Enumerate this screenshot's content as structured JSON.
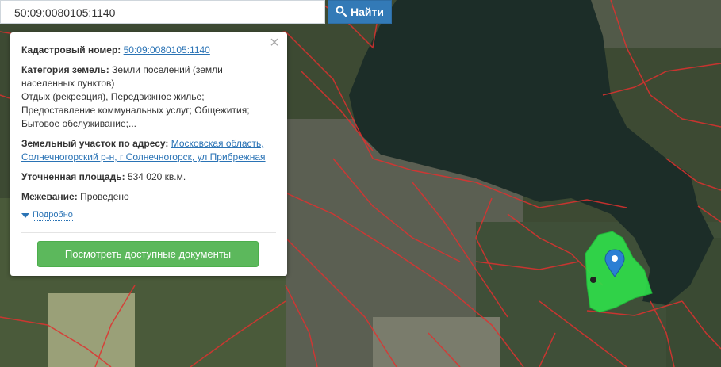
{
  "search": {
    "value": "50:09:0080105:1140",
    "button_label": "Найти"
  },
  "popup": {
    "cadastral_label": "Кадастровый номер:",
    "cadastral_value": "50:09:0080105:1140",
    "category_label": "Категория земель:",
    "category_text": "Земли поселений (земли населенных пунктов)",
    "usage_text": "Отдых (рекреация), Передвижное жилье; Предоставление коммунальных услуг; Общежития; Бытовое обслуживание;...",
    "address_label": "Земельный участок по адресу:",
    "address_value": "Московская область, Солнечногорский р-н, г Солнечногорск, ул Прибрежная",
    "area_label": "Уточненная площадь:",
    "area_value": "534 020 кв.м.",
    "survey_label": "Межевание:",
    "survey_value": "Проведено",
    "more_label": "Подробно",
    "docs_button_label": "Посмотреть доступные документы"
  },
  "colors": {
    "search_button": "#337ab7",
    "docs_button": "#5cb85c",
    "parcel_border": "#e0312f",
    "selected_parcel": "#2fe04a",
    "marker": "#2b7fd4",
    "lake": "#1c2d28"
  },
  "icons": {
    "search_button": "magnifier-icon",
    "close": "close-icon",
    "marker": "map-marker-icon",
    "more": "triangle-down-icon"
  }
}
